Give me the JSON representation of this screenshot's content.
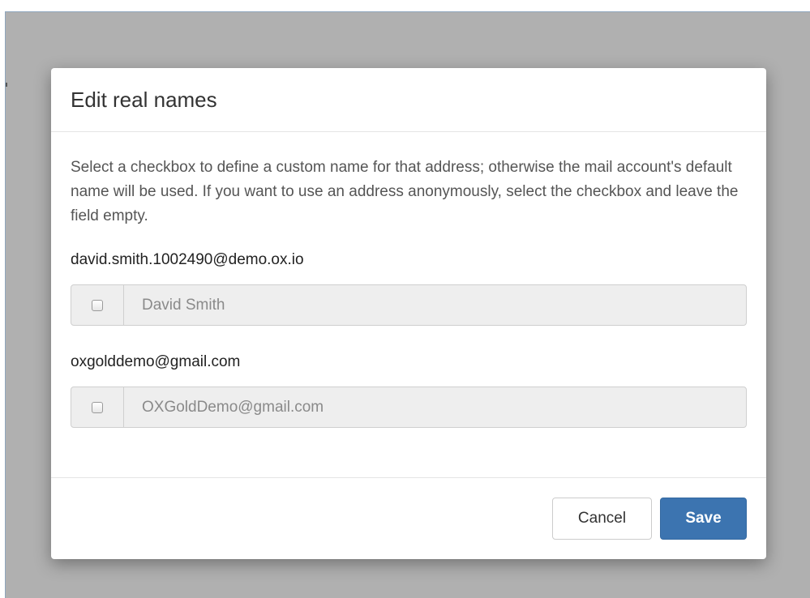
{
  "dialog": {
    "title": "Edit real names",
    "help_text": "Select a checkbox to define a custom name for that address; otherwise the mail account's default name will be used. If you want to use an address anonymously, select the checkbox and leave the field empty.",
    "addresses": [
      {
        "email": "david.smith.1002490@demo.ox.io",
        "name_placeholder": "David Smith",
        "checked": false
      },
      {
        "email": "oxgolddemo@gmail.com",
        "name_placeholder": "OXGoldDemo@gmail.com",
        "checked": false
      }
    ],
    "cancel_label": "Cancel",
    "save_label": "Save"
  },
  "colors": {
    "backdrop": "#b0b0b0",
    "primary": "#3c74b0"
  }
}
